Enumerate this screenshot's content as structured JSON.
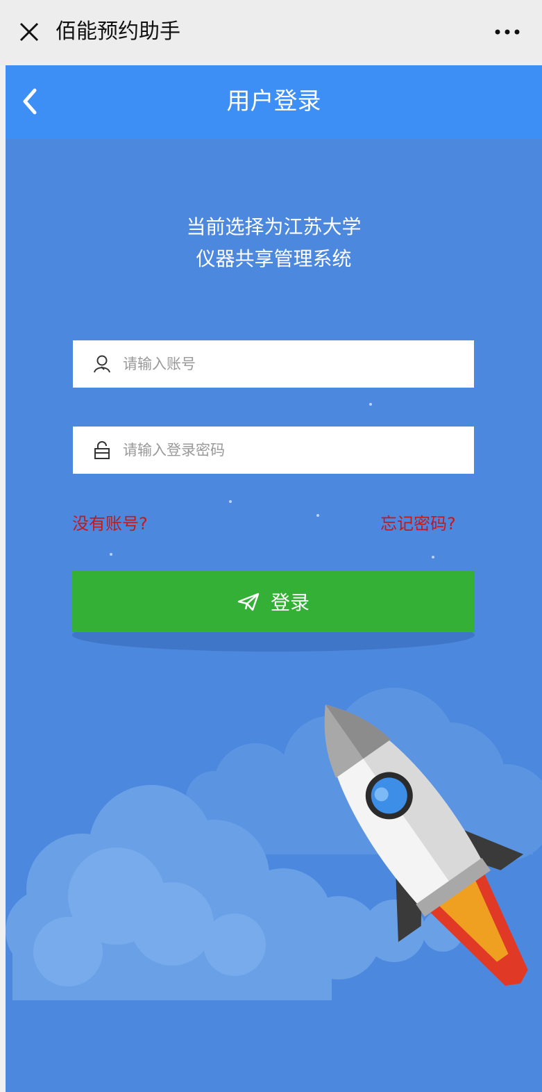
{
  "window": {
    "title": "佰能预约助手",
    "close_icon": "close-icon",
    "more_icon": "more-icon"
  },
  "navbar": {
    "title": "用户登录",
    "back_icon": "chevron-left-icon"
  },
  "headline": {
    "line1": "当前选择为江苏大学",
    "line2": "仪器共享管理系统"
  },
  "form": {
    "account": {
      "placeholder": "请输入账号",
      "value": "",
      "icon": "user-icon"
    },
    "password": {
      "placeholder": "请输入登录密码",
      "value": "",
      "icon": "lock-icon"
    }
  },
  "links": {
    "register": "没有账号?",
    "forgot": "忘记密码?"
  },
  "login_button": {
    "label": "登录",
    "icon": "paper-plane-icon"
  },
  "colors": {
    "topbar": "#ededed",
    "navbar": "#3d8ff5",
    "background": "#4d88df",
    "button": "#33b035",
    "link": "#c21a1a"
  }
}
